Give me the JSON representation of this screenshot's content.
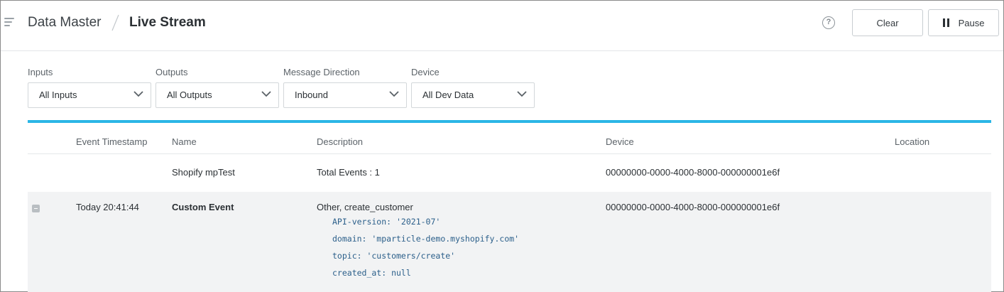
{
  "header": {
    "breadcrumb_root": "Data Master",
    "breadcrumb_current": "Live Stream",
    "clear_label": "Clear",
    "pause_label": "Pause"
  },
  "filters": [
    {
      "label": "Inputs",
      "value": "All Inputs"
    },
    {
      "label": "Outputs",
      "value": "All Outputs"
    },
    {
      "label": "Message Direction",
      "value": "Inbound"
    },
    {
      "label": "Device",
      "value": "All Dev Data"
    }
  ],
  "accent_color": "#2bb6e6",
  "table": {
    "columns": [
      "Event Timestamp",
      "Name",
      "Description",
      "Device",
      "Location"
    ],
    "rows": [
      {
        "timestamp": "",
        "name": "Shopify mpTest",
        "description": "Total Events : 1",
        "device": "00000000-0000-4000-8000-000000001e6f",
        "location": ""
      },
      {
        "expanded": true,
        "timestamp": "Today 20:41:44",
        "name": "Custom Event",
        "description": "Other, create_customer",
        "device": "00000000-0000-4000-8000-000000001e6f",
        "location": "",
        "attributes": [
          "API-version: '2021-07'",
          "domain: 'mparticle-demo.myshopify.com'",
          "topic: 'customers/create'",
          "created_at: null"
        ]
      }
    ]
  }
}
